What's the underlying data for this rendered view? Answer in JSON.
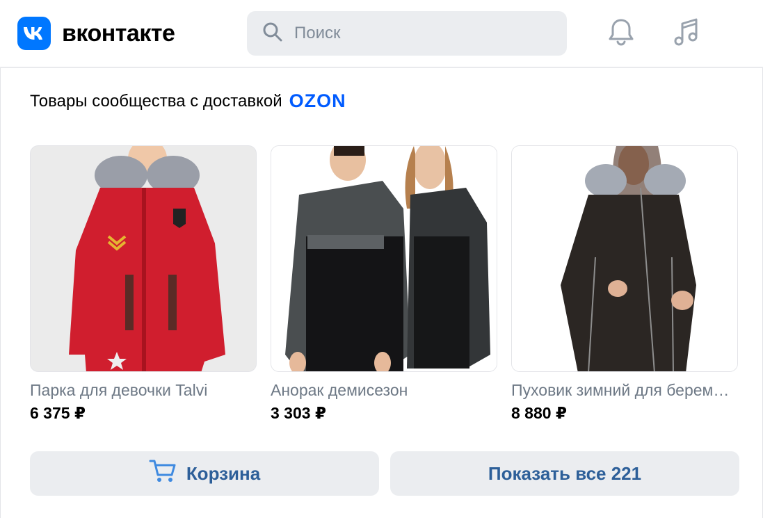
{
  "header": {
    "logo_text": "вконтакте",
    "search_placeholder": "Поиск"
  },
  "section": {
    "title": "Товары сообщества с доставкой",
    "partner_logo": "OZON"
  },
  "products": [
    {
      "name": "Парка для девочки Talvi",
      "price": "6 375 ₽"
    },
    {
      "name": "Анорак демисезон",
      "price": "3 303 ₽"
    },
    {
      "name": "Пуховик зимний для беременных",
      "price": "8 880 ₽"
    }
  ],
  "buttons": {
    "cart": "Корзина",
    "show_all": "Показать все 221"
  },
  "colors": {
    "brand": "#0077ff",
    "ozon": "#005bff",
    "link": "#2d5f99"
  },
  "icons": [
    "vk-logo-icon",
    "search-icon",
    "bell-icon",
    "music-icon",
    "cart-icon"
  ]
}
